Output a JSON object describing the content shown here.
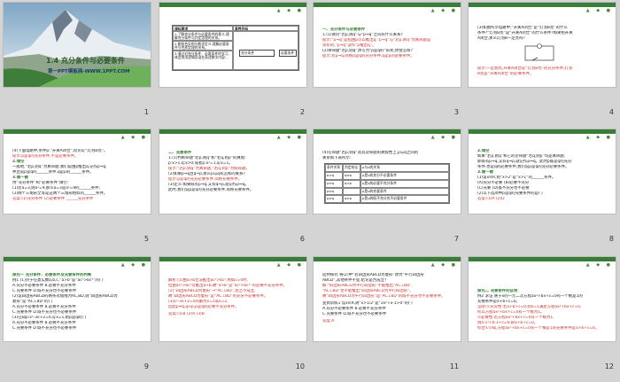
{
  "slides": [
    {
      "num": "1",
      "title": "1.4  充分条件与必要条件",
      "footer": "第一PPT模板网-WWW.1PPT.COM"
    },
    {
      "num": "2",
      "table": [
        "课标要求",
        "素养目标",
        "1.了解充分条件与必要条件的意义,理解充分条件与判定定理的关系。",
        "",
        "2.能结合实例与数学定义,理解必要条件与性质定理的关系。",
        "",
        "3.通过对充分条件、必要条件的学习,体会常用逻辑用语在表述数学内容...",
        "",
        "充分条件",
        "",
        "必要条件",
        ""
      ]
    },
    {
      "num": "3",
      "lines": [
        "一、充分条件与必要条件",
        "1.(1)请问“若p,则q”与“p⇒q”之间有什么关系?",
        "提示:“p⇒q”是指由p可以推出q,“p⇒q”与“若p,则q”为真命题是",
        "等价的,“p⇒q”读作“p推出q”。",
        "(2)将命题“若p,则q”改写为“p是q的”形式,你会怎样?",
        "提示:若p⇒q,则称p是q的充分条件,q是p的必要条件。"
      ]
    },
    {
      "num": "4",
      "lines": [
        "(3)如图所示电路中,“开关A闭合”是“灯泡B亮”的什么",
        "条件?“灯泡B亮”是“开关A闭合”的什么条件?如果把开关",
        "A闭合,那么灯泡B一定亮吗?",
        "提示:一定会亮,开关A闭合是“灯泡B亮”的充分条件,灯泡",
        "B亮是“开关A闭合”的必要条件。"
      ]
    },
    {
      "num": "5",
      "lines": [
        "(4)下面电路中,条件p:“开关A闭合”,结论q:“灯泡B亮”。",
        "提示:p是q的充分条件,不是必要条件。",
        "2.填空",
        "一般地,“若p,则q”为真命题,我们说由p推出q,记作p⇒q,",
        "并且说p是q的______条件,q是p的______条件。",
        "3.做一做",
        "用“充分条件”和“必要条件”填空:",
        "(1)若a=3,则a²=9,那么a=3是a²=9的______条件;",
        "(2)两个三角形全等是这两个三角形相似的______条件。",
        "答案:(1)充分条件 (2)必要条件  ______充分条件"
      ]
    },
    {
      "num": "6",
      "lines": [
        "二、充要条件",
        "1.(1)判断命题“若p,则q”和“若q,则p”的真假:",
        "p:x>1;q:x>0;或者p:x²=1,q:x=1。",
        "提示:“若p,则q”为真命题,“若q,则p”为假命题。",
        "(2)如果p⇒q且q⇒p,那么p与q有怎样的关系?",
        "提示:p是q的充分必要条件,简称充要条件。",
        "(3)定义:如果既有p⇒q,又有q⇒p,就记作p⇔q。",
        "此时,我们说p是q的充分必要条件,简称充要条件。"
      ]
    },
    {
      "num": "7",
      "lines": [
        "(4)在命题“若p,则q”及其逆命题的真假性上,p与q之间的",
        "关系如下表所示:"
      ],
      "table": [
        "条件关系",
        "判定结论",
        "p与q的关系",
        "p⇒q",
        "q⇏p",
        "p是q的充分不必要条件",
        "p⇏q",
        "q⇒p",
        "p是q的必要不充分条件",
        "p⇔q",
        "",
        "p是q的充要条件",
        "p⇏q",
        "q⇏p",
        "p是q的既不充分也不必要条件"
      ]
    },
    {
      "num": "8",
      "lines": [
        "2.填空",
        "如果“若p,则q”和它的逆命题“若q,则p”均是真命题,",
        "即既有p⇒q,又有q⇒p,就记作p⇔q。此时p既是q的充分",
        "条件,也是q的必要条件,我们说p是q的充分必要条件。",
        "3.做一做",
        "(1)设x∈R,则“x>2”是“x>1”的______条件。",
        "(A)充分不必要 (B)必要不充分",
        "(C)充要 (D)既不充分也不必要",
        "(2)以下选项中p是q的充要条件的是( )",
        "答案:(1)A (2)D"
      ]
    },
    {
      "num": "9",
      "lines": [
        "探究一 充分条件、必要条件及充要条件的判断",
        "例1 (1)对于任意实数a,b,c,“a>b”是“ac²>bc²”的( )",
        "A.充分不必要条件   B.必要不充分条件",
        "C.充要条件   D.既不充分也不必要条件",
        "(2)设四边形ABCD的两条对角线为AC,BD,则“四边形ABCD为",
        "菱形”是“AC⊥BD”的( )",
        "A.充分不必要条件   B.必要不充分条件",
        "C.充要条件   D.既不充分也不必要条件",
        "(3)已知p:x²-3x+2=0,q:x=1,则p是q的( )",
        "A.充分不必要条件   B.必要不充分条件",
        "C.充要条件   D.既不充分也不必要条件"
      ]
    },
    {
      "num": "10",
      "lines": [
        "解析:(1)由a>b无法推出ac²>bc²,例如c=0时,",
        "但由ac²>bc²可推出a>b,故“a>b”是“ac²>bc²”的必要不充分条件。",
        "(2)“四边形ABCD为菱形”⇒“AC⊥BD”,反之不成立,",
        "故“四边形ABCD为菱形”是“AC⊥BD”的充分不必要条件。",
        "(3)x²-3x+2=0的解为x=1或x=2,",
        "因此p⇏q,q⇒p,p是q的必要不充分条件。",
        "答案:(1)B (2)A (3)B"
      ]
    },
    {
      "num": "11",
      "lines": [
        "延伸探究 将(2)中“若四边形ABCD为菱形”改为“平行四边形",
        "ABCD”,其他条件不变,结论是否成立?",
        "解:“四边形ABCD为平行四边形”不能推出“AC⊥BD”,",
        "“AC⊥BD”也不能推出“四边形ABCD为平行四边形”,",
        "故“四边形ABCD为平行四边形”是“AC⊥BD”的既不充分也不必要条件。",
        "变式训练1 设x∈R,则“x>1/2”是“2x²+x-1>0”的( )",
        "A.充分不必要条件  B.必要不充分条件",
        "C.充要条件  D.既不充分也不必要条件",
        "答案:A"
      ]
    },
    {
      "num": "12",
      "lines": [
        "探究二 充要条件的证明",
        "例2 求证:关于x的一元二次方程ax²+bx+c=0有一个根是1的",
        "充要条件是a+b+c=0。",
        "证明:①充分性:若a+b+c=0,则x=1满足方程ax²+bx+c=0,",
        "所以方程ax²+bx+c=0有一个根为1。",
        "②必要性:若方程ax²+bx+c=0有一个根为1,",
        "则a·1²+b·1+c=0,即a+b+c=0。",
        "综合①②知,方程ax²+bx+c=0有一个根是1的充要条件是a+b+c=0。"
      ]
    }
  ]
}
